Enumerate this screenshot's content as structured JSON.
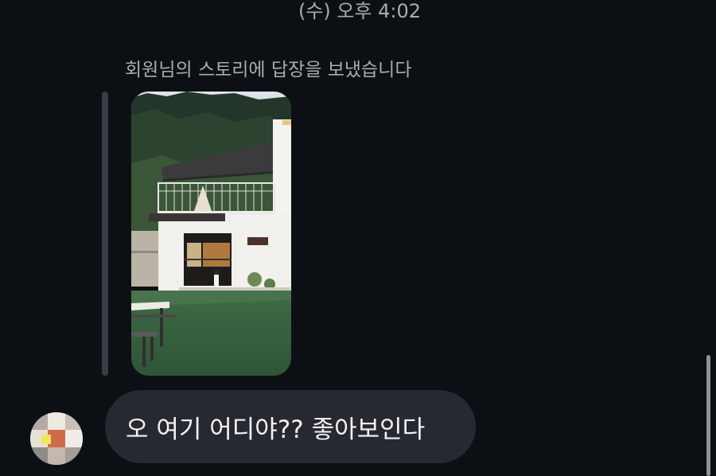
{
  "header": {
    "timestamp": "(수) 오후 4:02"
  },
  "thread": {
    "story_reply_note": "회원님의 스토리에 답장을 보냈습니다",
    "story_image_icon": "story-photo",
    "message_text": "오 여기 어디야?? 좋아보인다",
    "avatar_icon": "pixelated-avatar"
  },
  "colors": {
    "background": "#0c1014",
    "bubble": "#262a30",
    "secondary_text": "#a8acb1",
    "primary_text": "#f2f3f5"
  }
}
